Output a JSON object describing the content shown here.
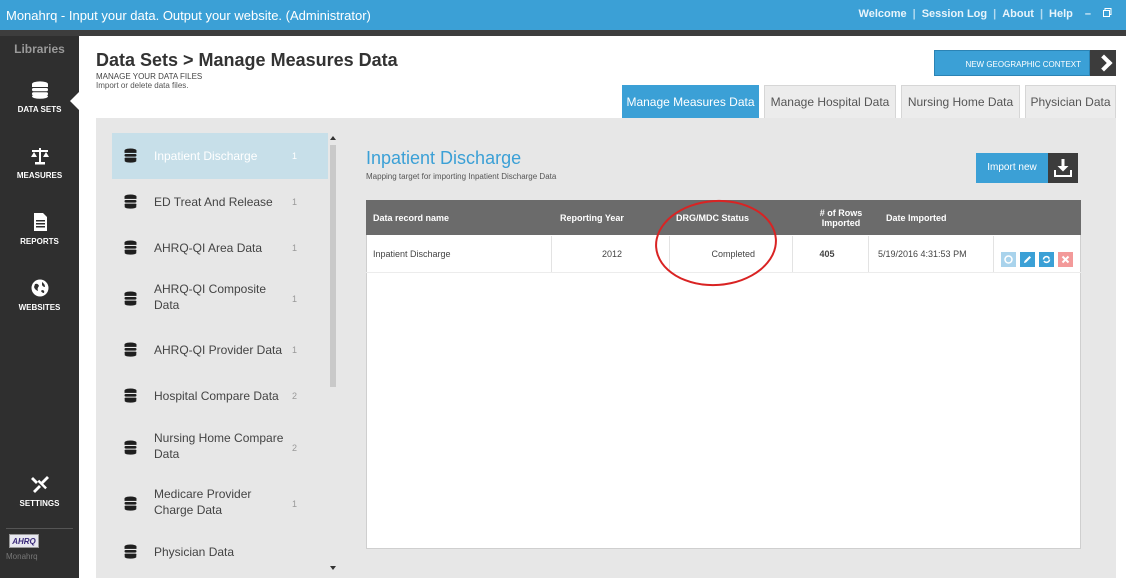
{
  "titlebar": {
    "app_title": "Monahrq - Input your data. Output your website.  (Administrator)",
    "links": [
      "Welcome",
      "Session Log",
      "About",
      "Help"
    ],
    "minimize_label": "–",
    "restore_label": "ⓓ"
  },
  "sidebar": {
    "header": "Libraries",
    "items": [
      {
        "label": "DATA SETS",
        "icon": "database-icon",
        "active": true
      },
      {
        "label": "MEASURES",
        "icon": "balance-scale-icon",
        "active": false
      },
      {
        "label": "REPORTS",
        "icon": "report-document-icon",
        "active": false
      },
      {
        "label": "WEBSITES",
        "icon": "globe-icon",
        "active": false
      },
      {
        "label": "SETTINGS",
        "icon": "settings-tools-icon",
        "active": false
      }
    ],
    "logo_text": "AHRQ",
    "brand_text": "Monahrq"
  },
  "header": {
    "title": "Data Sets > Manage Measures Data",
    "subtitle": "MANAGE YOUR DATA FILES",
    "description": "Import or delete data files.",
    "geo_button_label": "NEW GEOGRAPHIC CONTEXT"
  },
  "tabs": [
    {
      "label": "Manage Measures Data",
      "active": true
    },
    {
      "label": "Manage Hospital Data",
      "active": false
    },
    {
      "label": "Nursing Home Data",
      "active": false
    },
    {
      "label": "Physician Data",
      "active": false
    }
  ],
  "datasets": [
    {
      "label": "Inpatient Discharge",
      "count": "1",
      "active": true
    },
    {
      "label": "ED Treat And Release",
      "count": "1",
      "active": false
    },
    {
      "label": "AHRQ-QI Area Data",
      "count": "1",
      "active": false
    },
    {
      "label": "AHRQ-QI Composite Data",
      "line1": "AHRQ-QI Composite",
      "line2": "Data",
      "count": "1",
      "active": false
    },
    {
      "label": "AHRQ-QI Provider Data",
      "count": "1",
      "active": false
    },
    {
      "label": "Hospital Compare Data",
      "count": "2",
      "active": false
    },
    {
      "label": "Nursing Home Compare Data",
      "line1": "Nursing Home Compare",
      "line2": "Data",
      "count": "2",
      "active": false
    },
    {
      "label": "Medicare Provider Charge Data",
      "line1": "Medicare Provider",
      "line2": "Charge Data",
      "count": "1",
      "active": false
    },
    {
      "label": "Physician Data",
      "count": "",
      "active": false
    }
  ],
  "detail": {
    "title": "Inpatient Discharge",
    "description": "Mapping target for importing Inpatient Discharge Data",
    "import_button_label": "Import new",
    "table": {
      "columns": [
        "Data record name",
        "Reporting Year",
        "DRG/MDC Status",
        "# of Rows Imported",
        "Date Imported"
      ],
      "column_rows_line1": "# of Rows",
      "column_rows_line2": "Imported",
      "rows": [
        {
          "name": "Inpatient Discharge",
          "year": "2012",
          "status": "Completed",
          "rows_imported": "405",
          "date": "5/19/2016 4:31:53 PM",
          "actions": [
            "info-icon",
            "edit-pencil-icon",
            "refresh-icon",
            "delete-x-icon"
          ]
        }
      ]
    }
  },
  "colors": {
    "accent": "#3ba0d6",
    "sidebar": "#2f2f2f",
    "table_header": "#6b6b6b",
    "annotation": "#d92323",
    "delete": "#f39a9a"
  }
}
